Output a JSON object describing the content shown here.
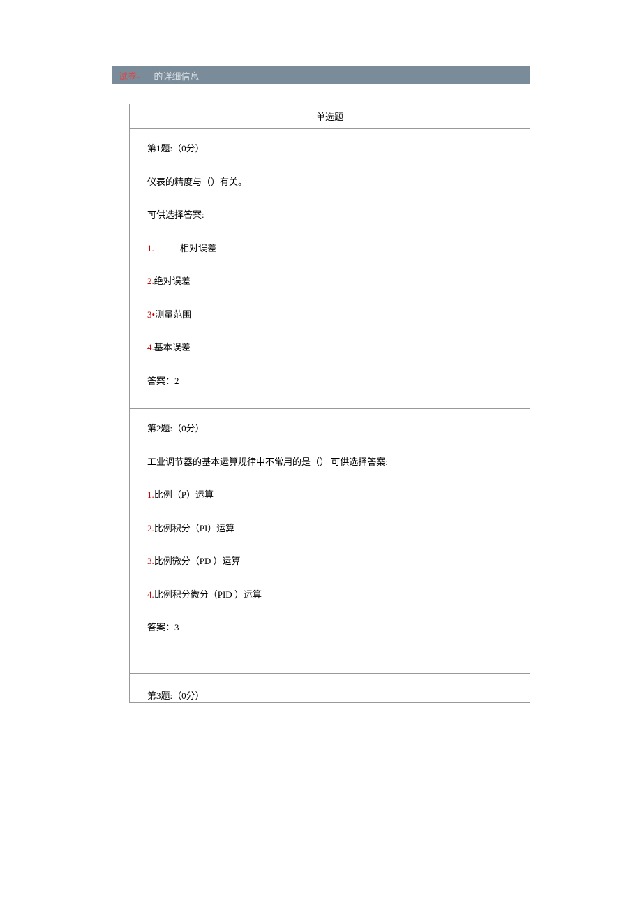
{
  "header": {
    "left": "试卷-",
    "right": "的详细信息"
  },
  "section_title": "单选题",
  "questions": [
    {
      "title": "第1题:（0分）",
      "stem": "仪表的精度与（）有关。",
      "choices_label": "可供选择答案:",
      "options": [
        {
          "num": "1.",
          "text": "相对误差",
          "indent": true
        },
        {
          "num": "2.",
          "text": "绝对误差",
          "indent": false
        },
        {
          "num": "3•",
          "text": "测量范围",
          "indent": false
        },
        {
          "num": "4.",
          "text": "基本误差",
          "indent": false
        }
      ],
      "answer_label": "答案：",
      "answer_value": "2"
    },
    {
      "title": "第2题:（0分）",
      "stem_combined": "工业调节器的基本运算规律中不常用的是（）   可供选择答案:",
      "options": [
        {
          "num": "1.",
          "text": "比例（P）运算"
        },
        {
          "num": "2.",
          "text": "比例积分（PI）运算"
        },
        {
          "num": "3.",
          "text": "比例微分（PD ）运算"
        },
        {
          "num": "4.",
          "text": "比例积分微分（PID ）运算"
        }
      ],
      "answer_label": "答案：",
      "answer_value": "3"
    },
    {
      "title": "第3题:（0分）"
    }
  ]
}
